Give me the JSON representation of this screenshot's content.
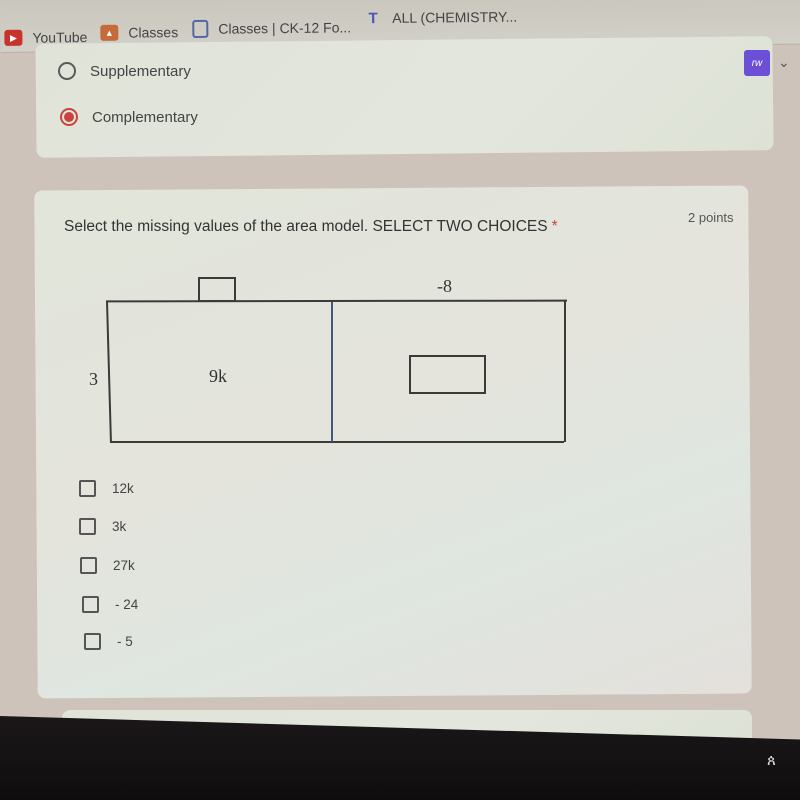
{
  "browser": {
    "bookmarks": [
      {
        "label": "YouTube",
        "icon": "youtube-icon",
        "color": "#c8332c"
      },
      {
        "label": "Classes",
        "icon": "google-classroom-icon",
        "color": "#c66a3a"
      },
      {
        "label": "Classes | CK-12 Fo...",
        "icon": "document-icon",
        "color": "#4f6aa3"
      },
      {
        "label": "ALL (CHEMISTRY...",
        "icon": "microsoft-teams-icon",
        "color": "#4b53bc"
      }
    ],
    "extension": {
      "label": "rw",
      "icon": "puzzle-extension-icon",
      "color": "#6b4fd6"
    }
  },
  "previous_question": {
    "options": [
      {
        "label": "Supplementary",
        "selected": false
      },
      {
        "label": "Complementary",
        "selected": true
      }
    ],
    "accent": "#c9443c"
  },
  "question": {
    "text": "Select the missing values of the area model. SELECT TWO CHOICES",
    "required_marker": "*",
    "points": "2 points",
    "area_model": {
      "top_left_label": "",
      "top_right_label": "-8",
      "side_label": "3",
      "left_cell": "9k",
      "right_cell": ""
    },
    "choices": [
      {
        "label": "12k",
        "checked": false
      },
      {
        "label": "3k",
        "checked": false
      },
      {
        "label": "27k",
        "checked": false
      },
      {
        "label": "- 24",
        "checked": false
      },
      {
        "label": "- 5",
        "checked": false
      }
    ]
  }
}
